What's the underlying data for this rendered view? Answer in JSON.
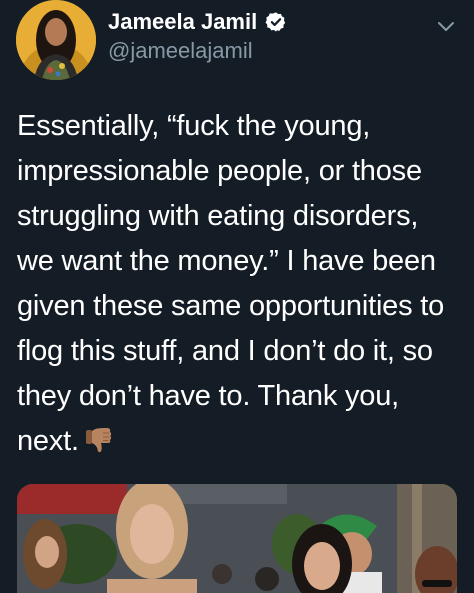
{
  "author": {
    "display_name": "Jameela Jamil",
    "handle": "@jameelajamil",
    "verified": true
  },
  "tweet": {
    "text": "Essentially, “fuck the young,\nimpressionable people, or those\nstruggling with eating disorders,\nwe want the money.” I have been\ngiven these same opportunities to\nflog this stuff, and I don’t do it, so\nthey don’t have to. Thank you,\nnext.",
    "emoji": "thumbs-down-emoji"
  },
  "icons": {
    "verified": "verified-badge-icon",
    "more": "chevron-down-icon"
  },
  "colors": {
    "background": "#141d26",
    "text": "#ffffff",
    "secondary": "#8899a6",
    "verified": "#ffffff"
  },
  "media": {
    "description_visible": false
  }
}
